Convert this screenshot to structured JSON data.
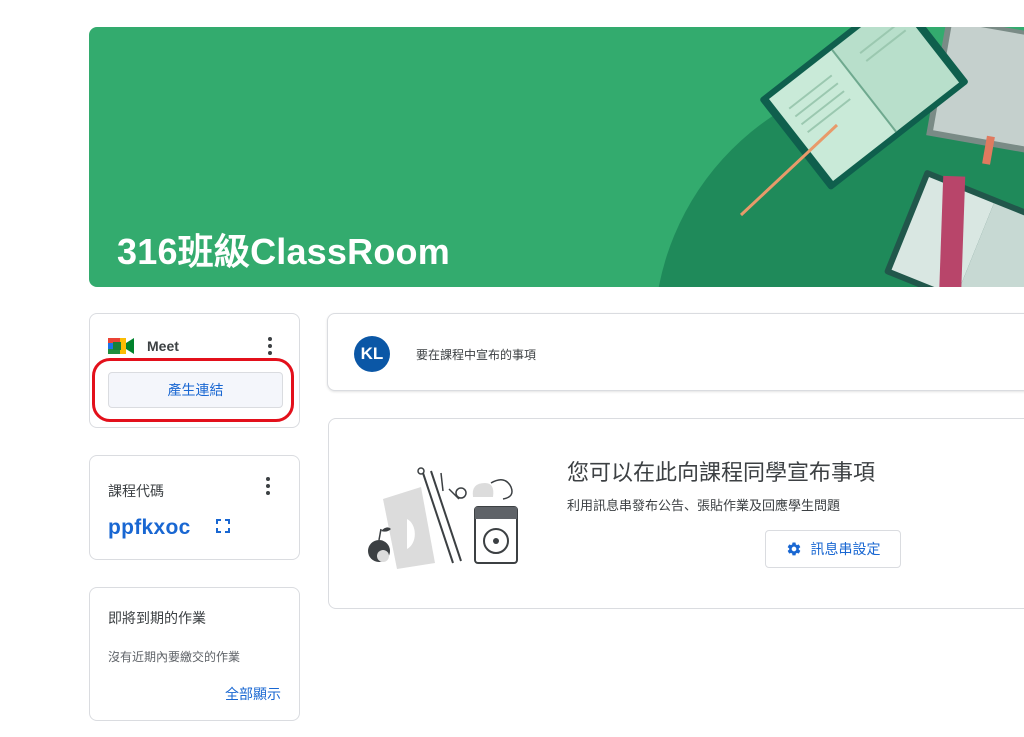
{
  "banner": {
    "title": "316班級ClassRoom",
    "bg_color": "#33ab6e"
  },
  "meet": {
    "title": "Meet",
    "generate_link_label": "產生連結",
    "menu_icon": "more-vert-icon",
    "highlight_color": "#e3101b"
  },
  "class_code": {
    "label": "課程代碼",
    "value": "ppfkxoc",
    "menu_icon": "more-vert-icon",
    "display_icon": "fullscreen-icon"
  },
  "upcoming": {
    "title": "即將到期的作業",
    "empty_text": "沒有近期內要繳交的作業",
    "view_all": "全部顯示"
  },
  "announce": {
    "avatar_initials": "KL",
    "prompt": "要在課程中宣布的事項",
    "avatar_color": "#0b57a6"
  },
  "stream_empty": {
    "heading": "您可以在此向課程同學宣布事項",
    "subtext": "利用訊息串發布公告、張貼作業及回應學生問題",
    "settings_button": "訊息串設定",
    "settings_icon": "gear-icon"
  },
  "colors": {
    "accent": "#1967d2",
    "border": "#dadce0",
    "text": "#3c4043"
  }
}
